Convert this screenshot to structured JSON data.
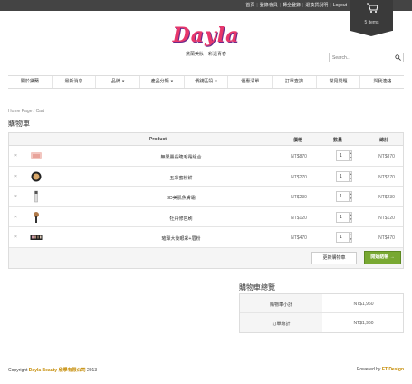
{
  "topbar": {
    "links": [
      "首頁",
      "登錄會員",
      "轉全登錄",
      "退換貨說明",
      "Logout"
    ],
    "cart_count": "5 items"
  },
  "logo": {
    "brand": "Dayla",
    "tagline": "黛蘭美妝・彩透青春"
  },
  "search": {
    "placeholder": "Search..."
  },
  "nav": [
    {
      "label": "關於黛蘭",
      "has_caret": false
    },
    {
      "label": "最新消息",
      "has_caret": false
    },
    {
      "label": "品牌",
      "has_caret": true
    },
    {
      "label": "產品分類",
      "has_caret": true
    },
    {
      "label": "價錢區段",
      "has_caret": true
    },
    {
      "label": "優惠清單",
      "has_caret": false
    },
    {
      "label": "訂單查詢",
      "has_caret": false
    },
    {
      "label": "常見問題",
      "has_caret": false
    },
    {
      "label": "與我連絡",
      "has_caret": false
    }
  ],
  "breadcrumb": "Home Page / Cart",
  "page_title": "購物車",
  "table": {
    "headers": {
      "product": "Product",
      "price": "價格",
      "qty": "數量",
      "subtotal": "總計"
    },
    "rows": [
      {
        "name": "無限量長睫毛霜組合",
        "price": "NT$870",
        "qty": "1",
        "subtotal": "NT$870",
        "thumb": "pink"
      },
      {
        "name": "五彩蜜粉餅",
        "price": "NT$270",
        "qty": "1",
        "subtotal": "NT$270",
        "thumb": "compact"
      },
      {
        "name": "3D美肌魚膚霜",
        "price": "NT$230",
        "qty": "1",
        "subtotal": "NT$230",
        "thumb": "tube"
      },
      {
        "name": "牡丹修容刷",
        "price": "NT$120",
        "qty": "1",
        "subtotal": "NT$120",
        "thumb": "brush"
      },
      {
        "name": "璀璨大後眼彩+眉粉",
        "price": "NT$470",
        "qty": "1",
        "subtotal": "NT$470",
        "thumb": "palette"
      }
    ],
    "update_label": "更新購物車",
    "checkout_label": "開始結帳 →"
  },
  "totals": {
    "title": "購物車總覽",
    "rows": [
      {
        "label": "購物車小計",
        "value": "NT$1,960"
      },
      {
        "label": "訂單總計",
        "value": "NT$1,960"
      }
    ]
  },
  "footer": {
    "left_prefix": "Copyright ",
    "left_brand": "Dayla Beauty 欣學有限公司",
    "left_year": " 2013",
    "right_prefix": "Powered by ",
    "right_brand": "FT Design"
  },
  "colors": {
    "accent": "#78a832",
    "brand": "#e8376b",
    "topbar": "#444444",
    "footer_highlight": "#c48a00"
  }
}
